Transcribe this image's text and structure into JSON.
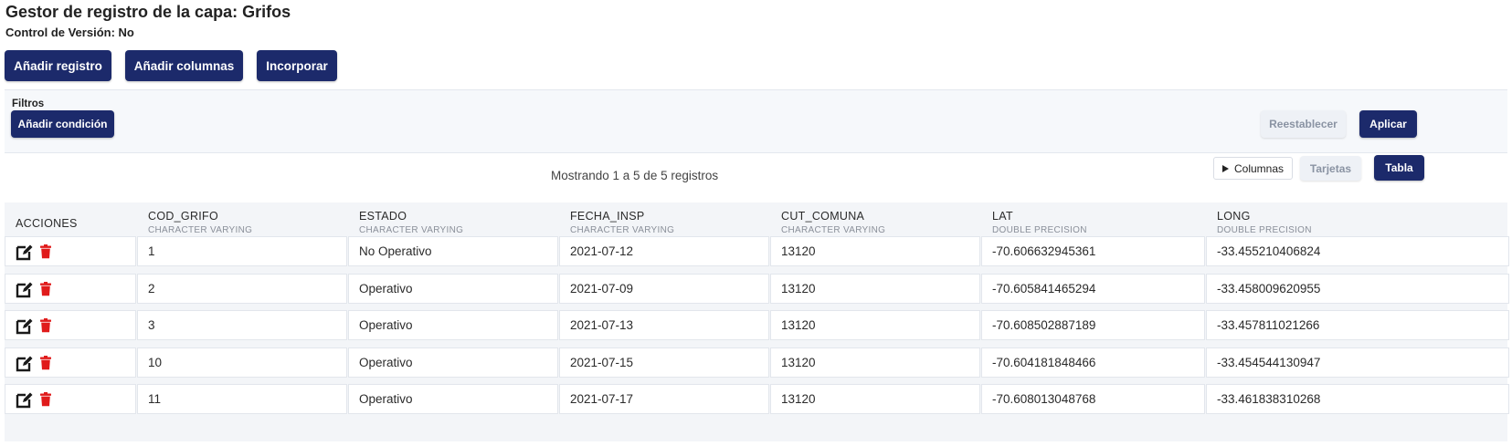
{
  "header": {
    "title": "Gestor de registro de la capa: Grifos",
    "version_label": "Control de Versión:",
    "version_value": "No"
  },
  "toolbar": {
    "add_record": "Añadir registro",
    "add_columns": "Añadir columnas",
    "incorporate": "Incorporar"
  },
  "filters": {
    "label": "Filtros",
    "add_condition": "Añadir condición",
    "reset": "Reestablecer",
    "apply": "Aplicar"
  },
  "view": {
    "records_info": "Mostrando 1 a 5 de 5 registros",
    "columns_button": "Columnas",
    "cards_button": "Tarjetas",
    "table_button": "Tabla"
  },
  "table": {
    "actions_header": "ACCIONES",
    "columns": [
      {
        "name": "COD_GRIFO",
        "type": "CHARACTER VARYING"
      },
      {
        "name": "ESTADO",
        "type": "CHARACTER VARYING"
      },
      {
        "name": "FECHA_INSP",
        "type": "CHARACTER VARYING"
      },
      {
        "name": "CUT_COMUNA",
        "type": "CHARACTER VARYING"
      },
      {
        "name": "LAT",
        "type": "DOUBLE PRECISION"
      },
      {
        "name": "LONG",
        "type": "DOUBLE PRECISION"
      }
    ],
    "rows": [
      [
        "1",
        "No Operativo",
        "2021-07-12",
        "13120",
        "-70.606632945361",
        "-33.455210406824"
      ],
      [
        "2",
        "Operativo",
        "2021-07-09",
        "13120",
        "-70.605841465294",
        "-33.458009620955"
      ],
      [
        "3",
        "Operativo",
        "2021-07-13",
        "13120",
        "-70.608502887189",
        "-33.457811021266"
      ],
      [
        "10",
        "Operativo",
        "2021-07-15",
        "13120",
        "-70.604181848466",
        "-33.454544130947"
      ],
      [
        "11",
        "Operativo",
        "2021-07-17",
        "13120",
        "-70.608013048768",
        "-33.461838310268"
      ]
    ]
  },
  "icons": {
    "edit": "edit-icon",
    "delete": "trash-icon",
    "columns_toggle": "play-icon"
  },
  "colors": {
    "primary": "#1c2a6b",
    "danger": "#e01b1b",
    "panel": "#f6f8fb"
  }
}
